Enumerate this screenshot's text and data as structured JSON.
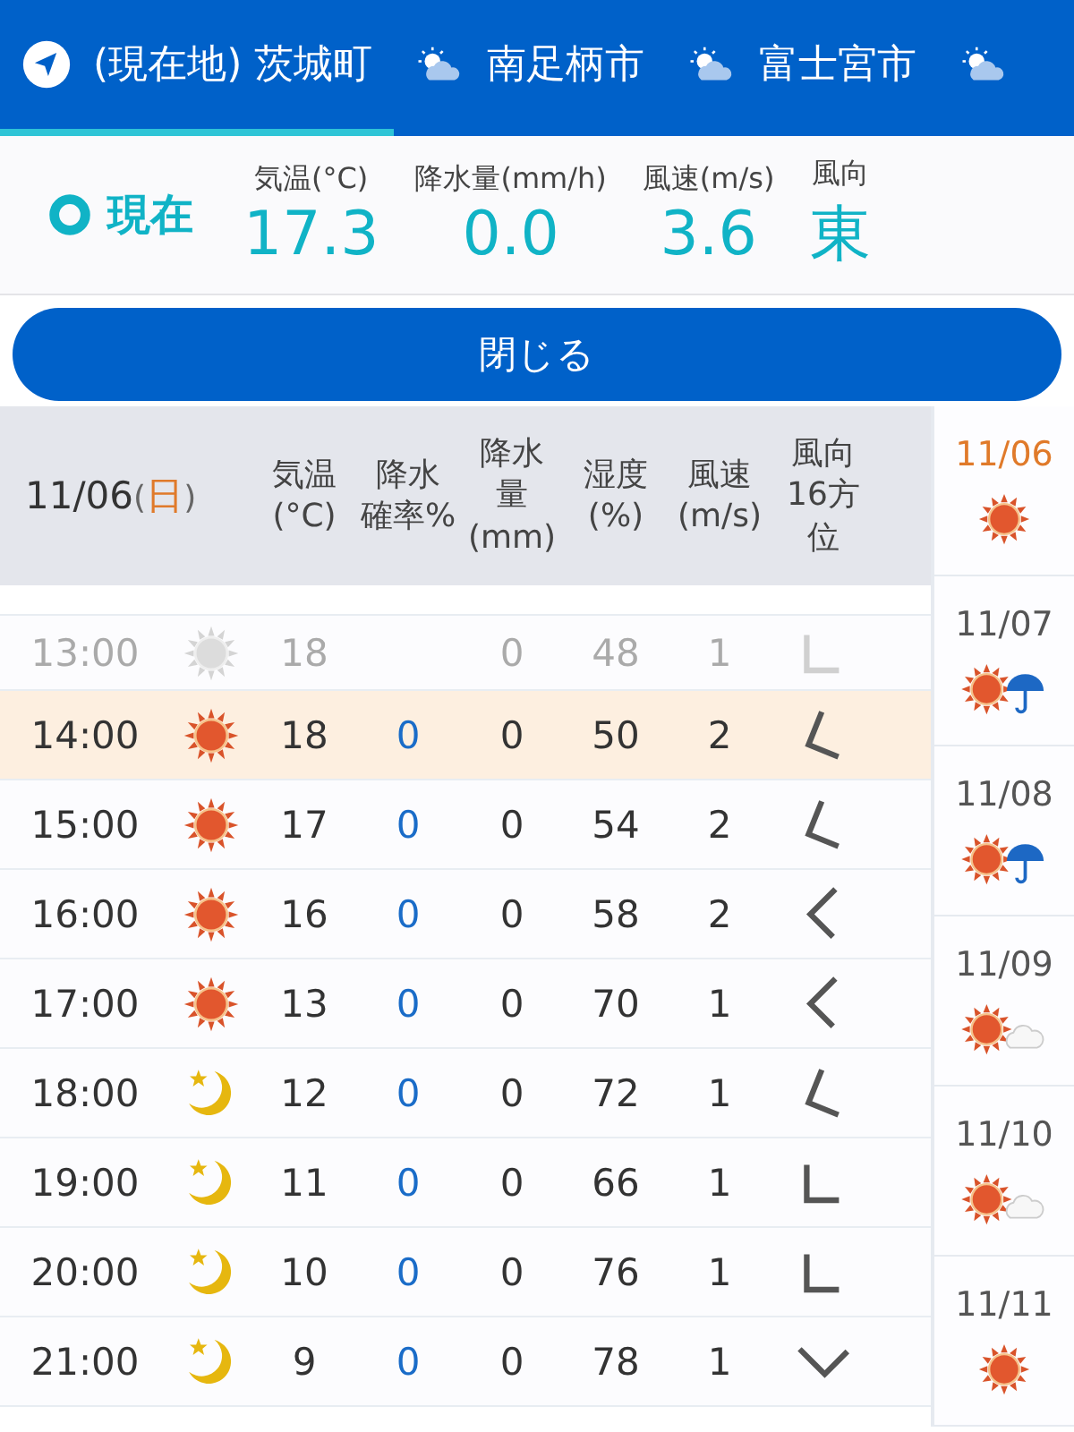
{
  "tabs": [
    {
      "kind": "location",
      "label": "(現在地) 茨城町",
      "selected": true
    },
    {
      "kind": "city",
      "label": "南足柄市",
      "selected": false
    },
    {
      "kind": "city",
      "label": "富士宮市",
      "selected": false
    },
    {
      "kind": "city",
      "selected": false
    }
  ],
  "current": {
    "label": "現在",
    "stats": [
      {
        "label": "気温(°C)",
        "value": "17.3"
      },
      {
        "label": "降水量(mm/h)",
        "value": "0.0"
      },
      {
        "label": "風速(m/s)",
        "value": "3.6"
      },
      {
        "label": "風向",
        "value": "東"
      }
    ]
  },
  "close_button": "閉じる",
  "table": {
    "date": "11/06",
    "weekday": {
      "open": "(",
      "day": "日",
      "close": ")",
      "holiday": true
    },
    "columns": [
      [
        "気温",
        "(°C)"
      ],
      [
        "降水",
        "確率%"
      ],
      [
        "降水",
        "量",
        "(mm)"
      ],
      [
        "湿度",
        "(%)"
      ],
      [
        "風速",
        "(m/s)"
      ],
      [
        "風向",
        "16方",
        "位"
      ]
    ],
    "rows": [
      {
        "time": "13:00",
        "kind": "sun",
        "temp": "18",
        "amount": "0",
        "humidity": "48",
        "wind_speed": "1",
        "wind": {
          "kind": "sw"
        },
        "past": true,
        "selected": false
      },
      {
        "time": "14:00",
        "kind": "sun",
        "temp": "18",
        "prob": "0",
        "amount": "0",
        "humidity": "50",
        "wind_speed": "2",
        "wind": {
          "kind": "wsw"
        },
        "past": false,
        "selected": true
      },
      {
        "time": "15:00",
        "kind": "sun",
        "temp": "17",
        "prob": "0",
        "amount": "0",
        "humidity": "54",
        "wind_speed": "2",
        "wind": {
          "kind": "wsw"
        },
        "past": false,
        "selected": false
      },
      {
        "time": "16:00",
        "kind": "sun",
        "temp": "16",
        "prob": "0",
        "amount": "0",
        "humidity": "58",
        "wind_speed": "2",
        "wind": {
          "kind": "w"
        },
        "past": false,
        "selected": false
      },
      {
        "time": "17:00",
        "kind": "sun",
        "temp": "13",
        "prob": "0",
        "amount": "0",
        "humidity": "70",
        "wind_speed": "1",
        "wind": {
          "kind": "w"
        },
        "past": false,
        "selected": false
      },
      {
        "time": "18:00",
        "kind": "moon",
        "temp": "12",
        "prob": "0",
        "amount": "0",
        "humidity": "72",
        "wind_speed": "1",
        "wind": {
          "kind": "wsw"
        },
        "past": false,
        "selected": false
      },
      {
        "time": "19:00",
        "kind": "moon",
        "temp": "11",
        "prob": "0",
        "amount": "0",
        "humidity": "66",
        "wind_speed": "1",
        "wind": {
          "kind": "sw"
        },
        "past": false,
        "selected": false
      },
      {
        "time": "20:00",
        "kind": "moon",
        "temp": "10",
        "prob": "0",
        "amount": "0",
        "humidity": "76",
        "wind_speed": "1",
        "wind": {
          "kind": "sw"
        },
        "past": false,
        "selected": false
      },
      {
        "time": "21:00",
        "kind": "moon",
        "temp": "9",
        "prob": "0",
        "amount": "0",
        "humidity": "78",
        "wind_speed": "1",
        "wind": {
          "kind": "s"
        },
        "past": false,
        "selected": false
      }
    ]
  },
  "days": [
    {
      "date": "11/06",
      "kind": "sun",
      "selected": true
    },
    {
      "date": "11/07",
      "kind": "sun_rain",
      "selected": false
    },
    {
      "date": "11/08",
      "kind": "sun_rain",
      "selected": false
    },
    {
      "date": "11/09",
      "kind": "sun_cloud",
      "selected": false
    },
    {
      "date": "11/10",
      "kind": "sun_cloud",
      "selected": false
    },
    {
      "date": "11/11",
      "kind": "sun",
      "selected": false
    }
  ]
}
